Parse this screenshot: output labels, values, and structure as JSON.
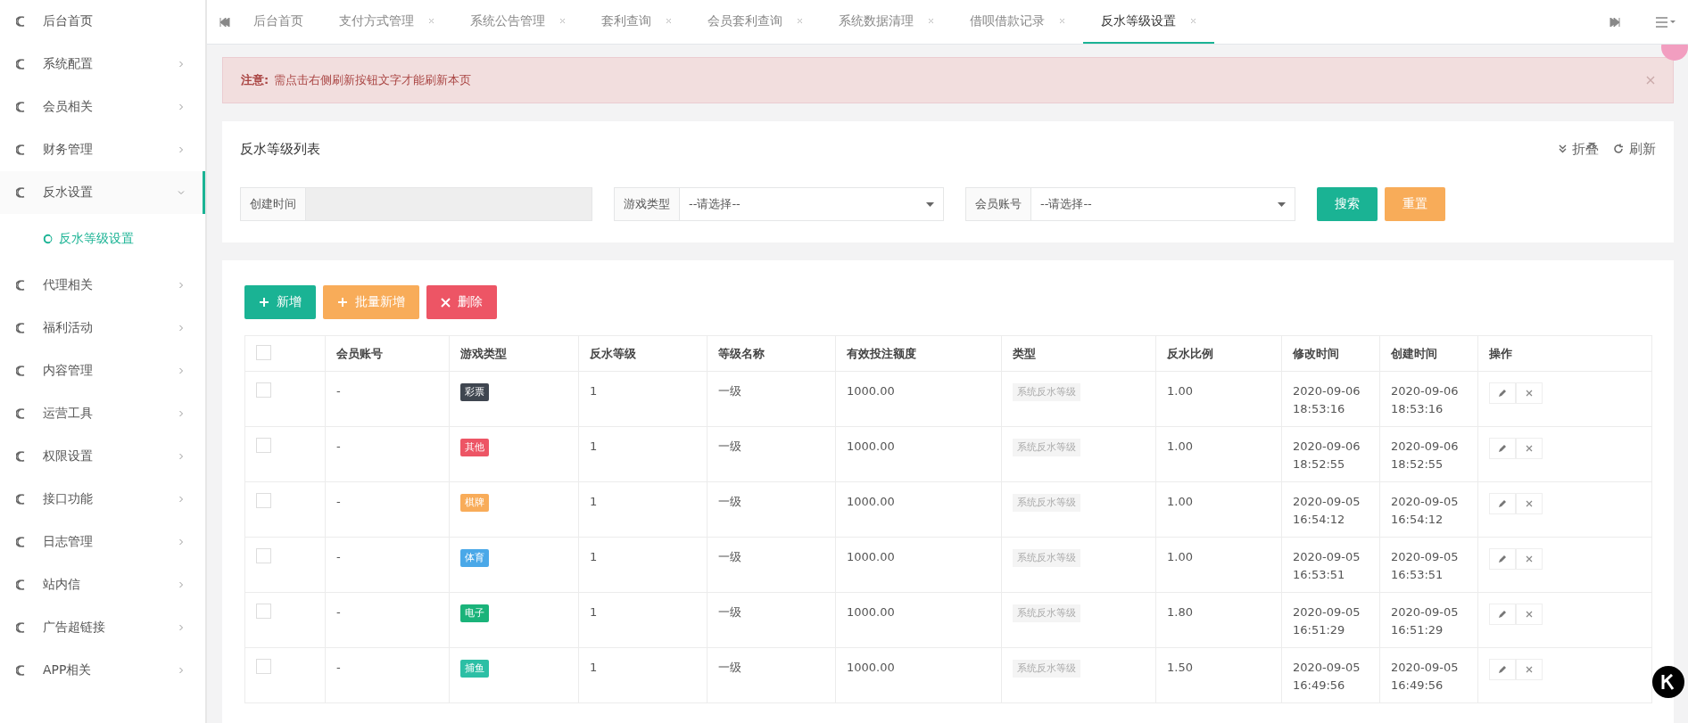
{
  "sidebar": {
    "items": [
      {
        "label": "后台首页",
        "has_arrow": false,
        "expanded": false
      },
      {
        "label": "系统配置",
        "has_arrow": true,
        "expanded": false
      },
      {
        "label": "会员相关",
        "has_arrow": true,
        "expanded": false
      },
      {
        "label": "财务管理",
        "has_arrow": true,
        "expanded": false
      },
      {
        "label": "反水设置",
        "has_arrow": true,
        "expanded": true,
        "children": [
          {
            "label": "反水等级设置",
            "selected": true
          }
        ]
      },
      {
        "label": "代理相关",
        "has_arrow": true,
        "expanded": false
      },
      {
        "label": "福利活动",
        "has_arrow": true,
        "expanded": false
      },
      {
        "label": "内容管理",
        "has_arrow": true,
        "expanded": false
      },
      {
        "label": "运营工具",
        "has_arrow": true,
        "expanded": false
      },
      {
        "label": "权限设置",
        "has_arrow": true,
        "expanded": false
      },
      {
        "label": "接口功能",
        "has_arrow": true,
        "expanded": false
      },
      {
        "label": "日志管理",
        "has_arrow": true,
        "expanded": false
      },
      {
        "label": "站内信",
        "has_arrow": true,
        "expanded": false
      },
      {
        "label": "广告超链接",
        "has_arrow": true,
        "expanded": false
      },
      {
        "label": "APP相关",
        "has_arrow": true,
        "expanded": false
      }
    ]
  },
  "tabs": [
    {
      "label": "后台首页",
      "closable": false,
      "selected": false
    },
    {
      "label": "支付方式管理",
      "closable": true,
      "selected": false
    },
    {
      "label": "系统公告管理",
      "closable": true,
      "selected": false
    },
    {
      "label": "套利查询",
      "closable": true,
      "selected": false
    },
    {
      "label": "会员套利查询",
      "closable": true,
      "selected": false
    },
    {
      "label": "系统数据清理",
      "closable": true,
      "selected": false
    },
    {
      "label": "借呗借款记录",
      "closable": true,
      "selected": false
    },
    {
      "label": "反水等级设置",
      "closable": true,
      "selected": true
    }
  ],
  "alert": {
    "title": "注意:",
    "message": "需点击右侧刷新按钮文字才能刷新本页"
  },
  "search_panel": {
    "title": "反水等级列表",
    "collapse": "折叠",
    "refresh": "刷新",
    "fields": [
      {
        "label": "创建时间",
        "kind": "input"
      },
      {
        "label": "游戏类型",
        "kind": "select",
        "value": "--请选择--"
      },
      {
        "label": "会员账号",
        "kind": "select",
        "value": "--请选择--"
      }
    ],
    "buttons": [
      {
        "label": "搜索",
        "kind": "primary"
      },
      {
        "label": "重置",
        "kind": "warning"
      }
    ]
  },
  "toolbar": [
    {
      "label": "新增",
      "kind": "primary"
    },
    {
      "label": "批量新增",
      "kind": "warning"
    },
    {
      "label": "删除",
      "kind": "danger"
    }
  ],
  "table": {
    "header_checked": false,
    "columns": [
      "会员账号",
      "游戏类型",
      "反水等级",
      "等级名称",
      "有效投注额度",
      "类型",
      "反水比例",
      "修改时间",
      "创建时间",
      "操作"
    ],
    "rows": [
      {
        "checked": false,
        "account": "-",
        "game_type": {
          "label": "彩票",
          "color": "#3f4650"
        },
        "level": "1",
        "level_name": "一级",
        "amount": "1000.00",
        "type": "系统反水等级",
        "ratio": "1.00",
        "modified": [
          "2020-09-06",
          "18:53:16"
        ],
        "created": [
          "2020-09-06",
          "18:53:16"
        ]
      },
      {
        "checked": false,
        "account": "-",
        "game_type": {
          "label": "其他",
          "color": "#ed5565"
        },
        "level": "1",
        "level_name": "一级",
        "amount": "1000.00",
        "type": "系统反水等级",
        "ratio": "1.00",
        "modified": [
          "2020-09-06",
          "18:52:55"
        ],
        "created": [
          "2020-09-06",
          "18:52:55"
        ]
      },
      {
        "checked": false,
        "account": "-",
        "game_type": {
          "label": "棋牌",
          "color": "#f8ac59"
        },
        "level": "1",
        "level_name": "一级",
        "amount": "1000.00",
        "type": "系统反水等级",
        "ratio": "1.00",
        "modified": [
          "2020-09-05",
          "16:54:12"
        ],
        "created": [
          "2020-09-05",
          "16:54:12"
        ]
      },
      {
        "checked": false,
        "account": "-",
        "game_type": {
          "label": "体育",
          "color": "#4aa8e8"
        },
        "level": "1",
        "level_name": "一级",
        "amount": "1000.00",
        "type": "系统反水等级",
        "ratio": "1.00",
        "modified": [
          "2020-09-05",
          "16:53:51"
        ],
        "created": [
          "2020-09-05",
          "16:53:51"
        ]
      },
      {
        "checked": false,
        "account": "-",
        "game_type": {
          "label": "电子",
          "color": "#1ab37a"
        },
        "level": "1",
        "level_name": "一级",
        "amount": "1000.00",
        "type": "系统反水等级",
        "ratio": "1.80",
        "modified": [
          "2020-09-05",
          "16:51:29"
        ],
        "created": [
          "2020-09-05",
          "16:51:29"
        ]
      },
      {
        "checked": false,
        "account": "-",
        "game_type": {
          "label": "捕鱼",
          "color": "#2cbfa5"
        },
        "level": "1",
        "level_name": "一级",
        "amount": "1000.00",
        "type": "系统反水等级",
        "ratio": "1.50",
        "modified": [
          "2020-09-05",
          "16:49:56"
        ],
        "created": [
          "2020-09-05",
          "16:49:56"
        ]
      }
    ]
  }
}
